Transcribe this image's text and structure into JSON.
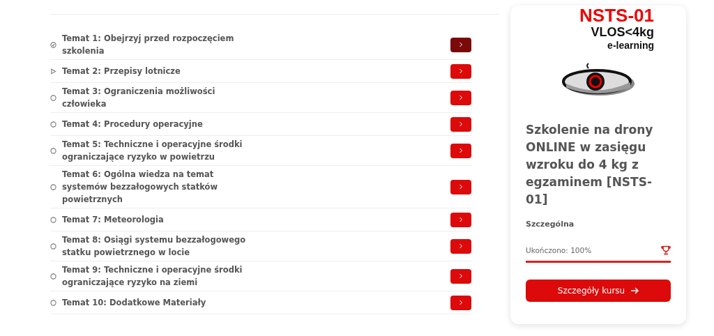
{
  "topics": [
    {
      "title": "Temat 1: Obejrzyj przed rozpoczęciem szkolenia",
      "kind": "done",
      "selected": true
    },
    {
      "title": "Temat 2: Przepisy lotnicze",
      "kind": "current",
      "selected": false
    },
    {
      "title": "Temat 3: Ograniczenia możliwości człowieka",
      "kind": "todo",
      "selected": false
    },
    {
      "title": "Temat 4: Procedury operacyjne",
      "kind": "todo",
      "selected": false
    },
    {
      "title": "Temat 5: Techniczne i operacyjne środki ograniczające ryzyko w powietrzu",
      "kind": "todo",
      "selected": false
    },
    {
      "title": "Temat 6: Ogólna wiedza na temat systemów bezzałogowych statków powietrznych",
      "kind": "todo",
      "selected": false
    },
    {
      "title": "Temat 7: Meteorologia",
      "kind": "todo",
      "selected": false
    },
    {
      "title": "Temat 8: Osiągi systemu bezzałogowego statku powietrznego w locie",
      "kind": "todo",
      "selected": false
    },
    {
      "title": "Temat 9: Techniczne i operacyjne środki ograniczające ryzyko na ziemi",
      "kind": "todo",
      "selected": false
    },
    {
      "title": "Temat 10: Dodatkowe Materiały",
      "kind": "todo",
      "selected": false
    }
  ],
  "course": {
    "logo_code": "NSTS-01",
    "logo_line_2": "VLOS<4kg",
    "logo_line_3": "e-learning",
    "title": "Szkolenie na drony ONLINE w zasięgu wzroku do 4 kg z egzaminem [NSTS-01]",
    "category": "Szczególna",
    "progress_label": "Ukończono: 100%",
    "level": 1,
    "button": "Szczegóły kursu"
  }
}
